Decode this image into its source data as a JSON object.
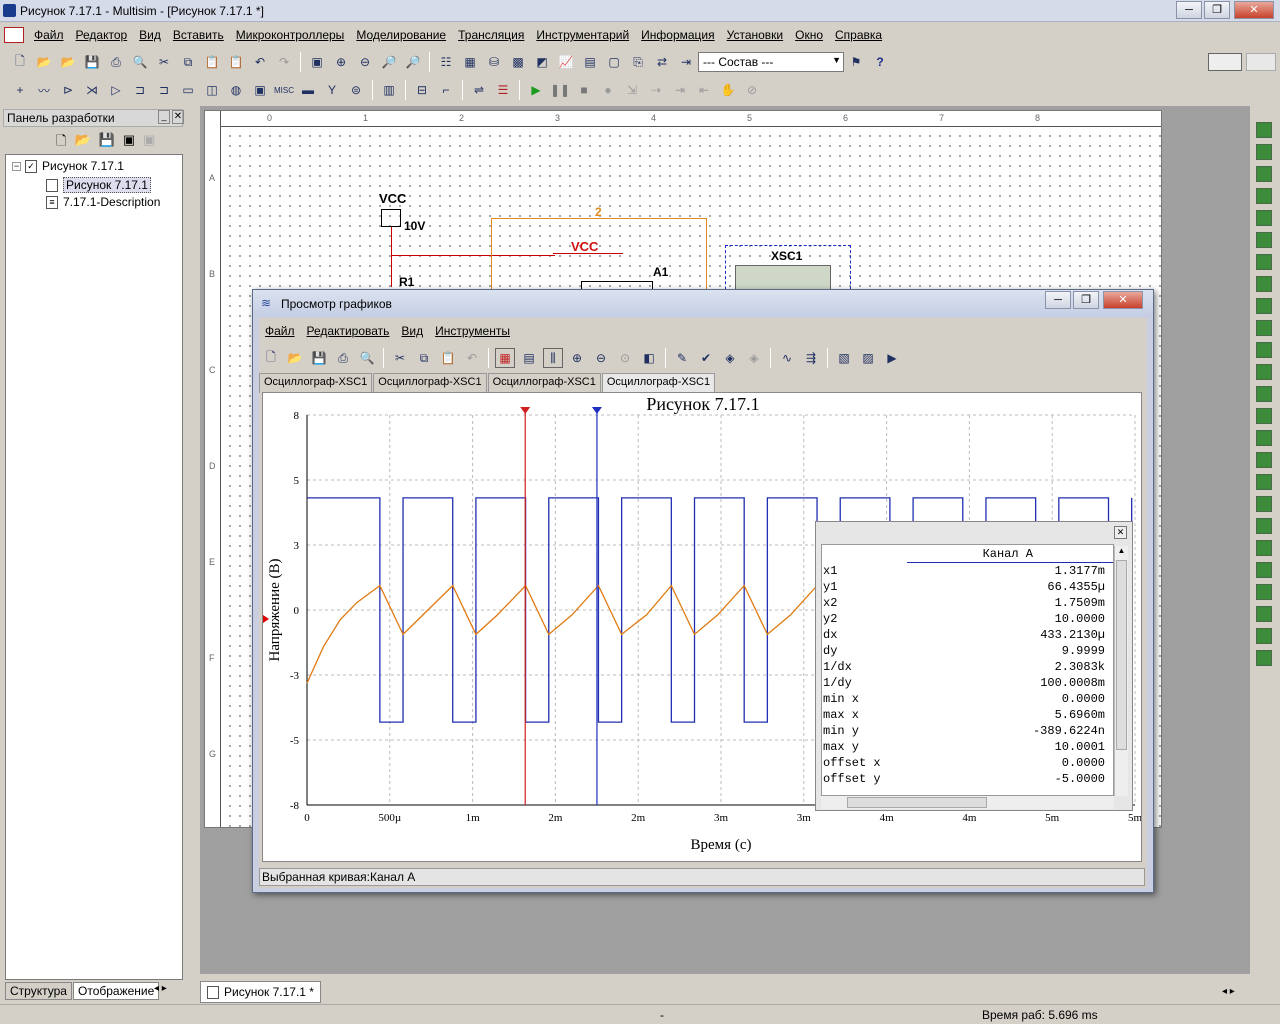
{
  "window": {
    "title": "Рисунок 7.17.1 - Multisim - [Рисунок 7.17.1 *]"
  },
  "menu": [
    "Файл",
    "Редактор",
    "Вид",
    "Вставить",
    "Микроконтроллеры",
    "Моделирование",
    "Трансляция",
    "Инструментарий",
    "Информация",
    "Установки",
    "Окно",
    "Справка"
  ],
  "toolbar": {
    "combo": "--- Состав ---"
  },
  "left_panel": {
    "title": "Панель разработки",
    "tree": [
      "Рисунок 7.17.1",
      "Рисунок 7.17.1",
      "7.17.1-Description"
    ],
    "tabs": [
      "Структура",
      "Отображение"
    ]
  },
  "schematic": {
    "vcc_label": "VCC",
    "vcc_value": "10V",
    "r1": "R1",
    "net2": "2",
    "vcc2": "VCC",
    "a1": "A1",
    "xsc1": "XSC1",
    "col_ticks": [
      "0",
      "1",
      "2",
      "3",
      "4",
      "5",
      "6",
      "7",
      "8"
    ],
    "row_ticks": [
      "A",
      "B",
      "C",
      "D",
      "E",
      "F",
      "G"
    ]
  },
  "doc_tab": "Рисунок 7.17.1 *",
  "status": {
    "center": "-",
    "right": "Время раб: 5.696 ms"
  },
  "grapher": {
    "title": "Просмотр графиков",
    "menu": [
      "Файл",
      "Редактировать",
      "Вид",
      "Инструменты"
    ],
    "tabs": [
      "Осциллограф-XSC1",
      "Осциллограф-XSC1",
      "Осциллограф-XSC1",
      "Осциллограф-XSC1"
    ],
    "status": "Выбранная кривая:Канал А"
  },
  "chart_data": {
    "type": "line",
    "title": "Рисунок 7.17.1",
    "xlabel": "Время (с)",
    "ylabel": "Напряжение (В)",
    "x_ticks": [
      "0",
      "500µ",
      "1m",
      "2m",
      "2m",
      "3m",
      "3m",
      "4m",
      "4m",
      "5m",
      "5m"
    ],
    "y_ticks": [
      "8",
      "5",
      "3",
      "0",
      "-3",
      "-5",
      "-8"
    ],
    "xlim": [
      0,
      0.005
    ],
    "ylim": [
      -8,
      8
    ],
    "grid": true,
    "series": [
      {
        "color": "#1f2fb0",
        "x": [
          0,
          0.00044,
          0.00044,
          0.00058,
          0.00058,
          0.00088,
          0.00088,
          0.00102,
          0.00102,
          0.00132,
          0.00132,
          0.00146,
          0.00146,
          0.00176,
          0.00176,
          0.0019,
          0.0019,
          0.0022,
          0.0022,
          0.00234,
          0.00234,
          0.00264,
          0.00264,
          0.00278,
          0.00278,
          0.00308,
          0.00308,
          0.00322,
          0.00322,
          0.00352,
          0.00352,
          0.00366,
          0.00366,
          0.00396,
          0.00396,
          0.0041,
          0.0041,
          0.0044,
          0.0044,
          0.00454,
          0.00454,
          0.00484,
          0.00484,
          0.00498,
          0.00498
        ],
        "y": [
          4.6,
          4.6,
          -4.6,
          -4.6,
          4.6,
          4.6,
          -4.6,
          -4.6,
          4.6,
          4.6,
          -4.6,
          -4.6,
          4.6,
          4.6,
          -4.6,
          -4.6,
          4.6,
          4.6,
          -4.6,
          -4.6,
          4.6,
          4.6,
          -4.6,
          -4.6,
          4.6,
          4.6,
          -4.6,
          -4.6,
          4.6,
          4.6,
          -4.6,
          -4.6,
          4.6,
          4.6,
          -4.6,
          -4.6,
          4.6,
          4.6,
          -4.6,
          -4.6,
          4.6,
          4.6,
          -4.6,
          -4.6,
          4.6
        ]
      },
      {
        "color": "#e07a10",
        "x": [
          0,
          0.0001,
          0.0002,
          0.0003,
          0.00044,
          0.00058,
          0.0007,
          0.00088,
          0.00102,
          0.00115,
          0.00132,
          0.00146,
          0.0016,
          0.00176,
          0.0019,
          0.00205,
          0.0022,
          0.00234,
          0.00248,
          0.00264,
          0.00278,
          0.00292,
          0.00308,
          0.00322,
          0.0033
        ],
        "y": [
          -3.0,
          -1.5,
          -0.4,
          0.3,
          1.0,
          -1.0,
          -0.2,
          1.0,
          -1.0,
          -0.2,
          1.0,
          -1.0,
          -0.2,
          1.0,
          -1.0,
          -0.2,
          1.0,
          -1.0,
          -0.2,
          1.0,
          -1.0,
          -0.2,
          1.0,
          -1.0,
          -0.5
        ]
      }
    ],
    "cursors": [
      {
        "x": 0.0013177,
        "color": "#d02020"
      },
      {
        "x": 0.0017509,
        "color": "#2030c0"
      }
    ],
    "cursor_table": {
      "header": "Канал А",
      "rows": [
        [
          "x1",
          "1.3177m"
        ],
        [
          "y1",
          "66.4355µ"
        ],
        [
          "x2",
          "1.7509m"
        ],
        [
          "y2",
          "10.0000"
        ],
        [
          "dx",
          "433.2130µ"
        ],
        [
          "dy",
          "9.9999"
        ],
        [
          "1/dx",
          "2.3083k"
        ],
        [
          "1/dy",
          "100.0008m"
        ],
        [
          "min x",
          "0.0000"
        ],
        [
          "max x",
          "5.6960m"
        ],
        [
          "min y",
          "-389.6224n"
        ],
        [
          "max y",
          "10.0001"
        ],
        [
          "offset x",
          "0.0000"
        ],
        [
          "offset y",
          "-5.0000"
        ]
      ]
    }
  }
}
